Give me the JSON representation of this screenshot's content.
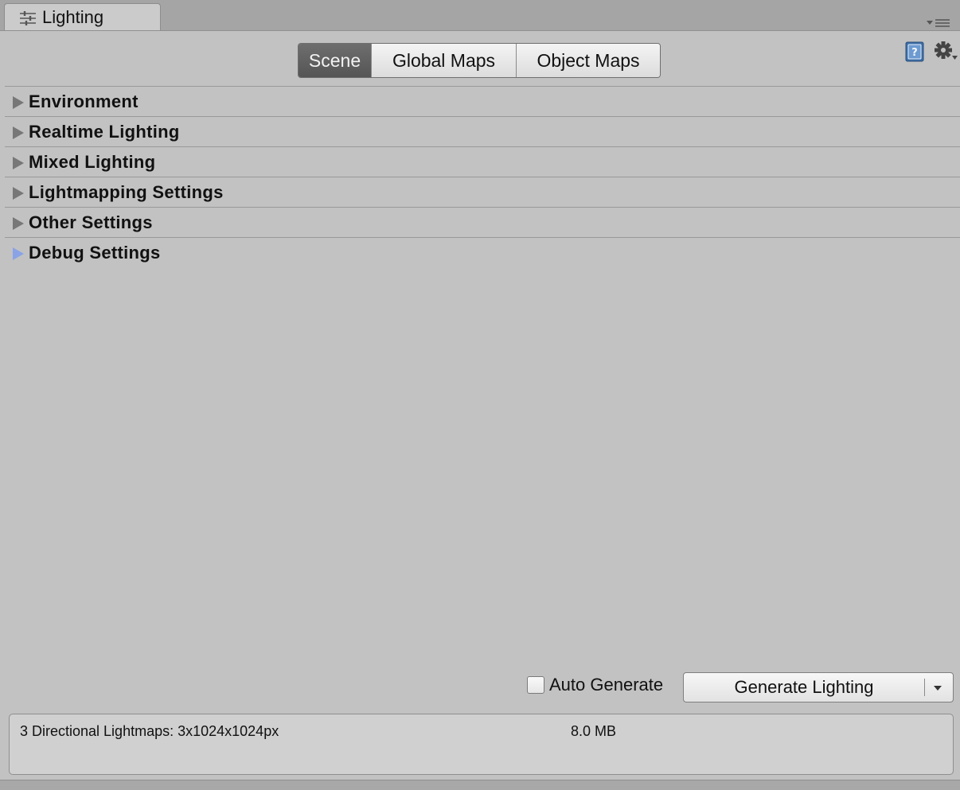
{
  "window": {
    "tab_title": "Lighting",
    "tab_icon": "sliders-icon"
  },
  "toolbar": {
    "tabs": [
      {
        "label": "Scene",
        "active": true
      },
      {
        "label": "Global Maps",
        "active": false
      },
      {
        "label": "Object Maps",
        "active": false
      }
    ],
    "help_icon": "help-book-icon",
    "settings_icon": "gear-icon"
  },
  "sections": [
    {
      "label": "Environment"
    },
    {
      "label": "Realtime Lighting"
    },
    {
      "label": "Mixed Lighting"
    },
    {
      "label": "Lightmapping Settings"
    },
    {
      "label": "Other Settings"
    },
    {
      "label": "Debug Settings",
      "highlight": true
    }
  ],
  "bottom": {
    "auto_generate_label": "Auto Generate",
    "auto_generate_checked": false,
    "generate_button_label": "Generate Lighting"
  },
  "info": {
    "lightmaps": "3 Directional Lightmaps: 3x1024x1024px",
    "size": "8.0 MB"
  },
  "colors": {
    "background": "#c2c2c2",
    "active_tab": "#5e5e5e",
    "debug_arrow": "#8aa3e6"
  }
}
